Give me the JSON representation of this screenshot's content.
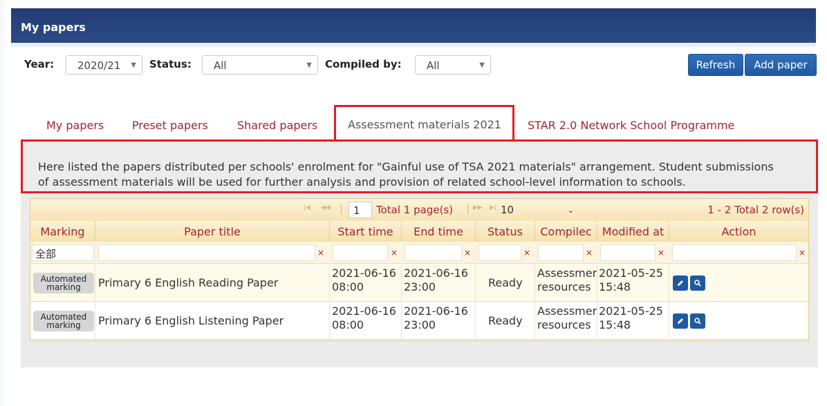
{
  "page": {
    "title": "My papers"
  },
  "filters": {
    "year_label": "Year:",
    "year_value": "2020/21",
    "status_label": "Status:",
    "status_value": "All",
    "compiled_label": "Compiled by:",
    "compiled_value": "All"
  },
  "buttons": {
    "refresh": "Refresh",
    "add_paper": "Add paper"
  },
  "tabs": [
    {
      "label": "My papers",
      "active": false
    },
    {
      "label": "Preset papers",
      "active": false
    },
    {
      "label": "Shared papers",
      "active": false
    },
    {
      "label": "Assessment materials 2021",
      "active": true
    },
    {
      "label": "STAR 2.0 Network School Programme",
      "active": false
    }
  ],
  "description": {
    "line1": "Here listed the papers distributed per schools' enrolment for \"Gainful use of TSA 2021 materials\" arrangement. Student submissions",
    "line2": "of assessment materials will be used for further analysis and provision of related school-level information to schools."
  },
  "pager": {
    "page": "1",
    "total_pages": "Total 1 page(s)",
    "page_size": "10",
    "rows_info": "1 - 2 Total 2 row(s)"
  },
  "table": {
    "columns": [
      "Marking",
      "Paper title",
      "Start time",
      "End time",
      "Status",
      "Compilec",
      "Modified at",
      "Action"
    ],
    "filter_marking": "全部",
    "clear_symbol": "×",
    "rows": [
      {
        "marking_line1": "Automated",
        "marking_line2": "marking",
        "title": "Primary 6 English Reading Paper",
        "start_date": "2021-06-16",
        "start_time": "08:00",
        "end_date": "2021-06-16",
        "end_time": "23:00",
        "status": "Ready",
        "compiled_line1": "Assessmer",
        "compiled_line2": "resources",
        "modified_date": "2021-05-25",
        "modified_time": "15:48"
      },
      {
        "marking_line1": "Automated",
        "marking_line2": "marking",
        "title": "Primary 6 English Listening Paper",
        "start_date": "2021-06-16",
        "start_time": "08:00",
        "end_date": "2021-06-16",
        "end_time": "23:00",
        "status": "Ready",
        "compiled_line1": "Assessmer",
        "compiled_line2": "resources",
        "modified_date": "2021-05-25",
        "modified_time": "15:48"
      }
    ]
  },
  "colors": {
    "header_bar": "#223c74",
    "accent_red": "#a3242f",
    "highlight_border": "#e31c23",
    "button_blue": "#1f5aa0"
  }
}
